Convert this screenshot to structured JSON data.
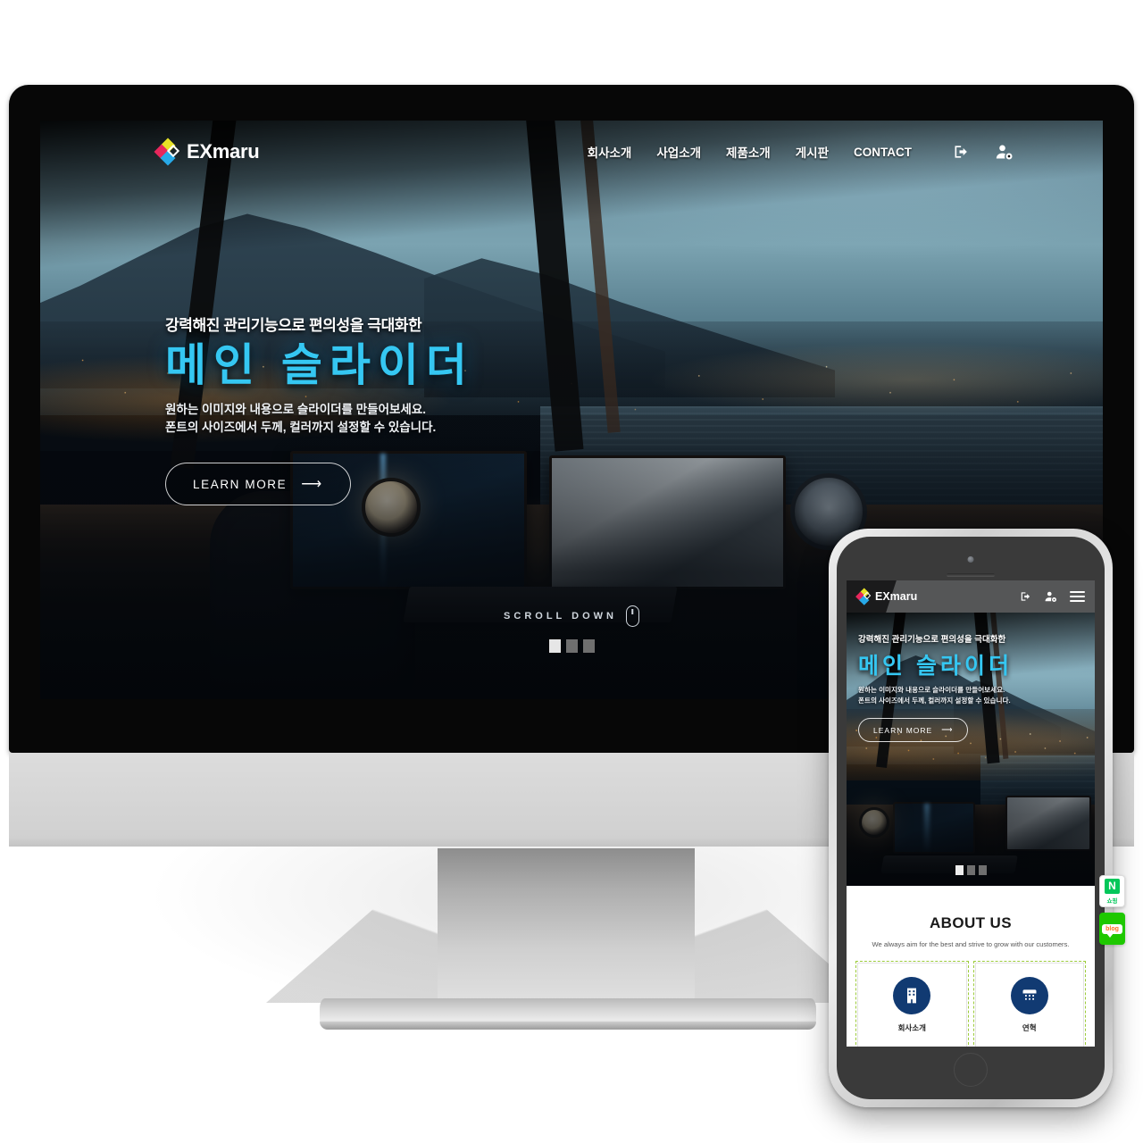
{
  "brand": {
    "name": "EXmaru",
    "logo_colors": [
      "#e8e226",
      "#e8275c",
      "#27a9e8",
      "#ffffff"
    ]
  },
  "desktop": {
    "nav": [
      {
        "label": "회사소개"
      },
      {
        "label": "사업소개"
      },
      {
        "label": "제품소개"
      },
      {
        "label": "게시판"
      },
      {
        "label": "CONTACT"
      }
    ],
    "nav_icons": [
      {
        "name": "logout-icon"
      },
      {
        "name": "user-settings-icon"
      }
    ],
    "hero": {
      "eyebrow": "강력해진 관리기능으로 편의성을 극대화한",
      "title": "메인 슬라이더",
      "desc_line1": "원하는 이미지와 내용으로 슬라이더를 만들어보세요.",
      "desc_line2": "폰트의 사이즈에서 두께, 컬러까지 설정할 수 있습니다.",
      "cta": "LEARN MORE",
      "cta_arrow": "⟶",
      "title_color": "#35c7f2"
    },
    "scroll": {
      "label": "SCROLL DOWN",
      "slides": 3,
      "active_slide": 1
    }
  },
  "mobile": {
    "header_icons": [
      {
        "name": "logout-icon"
      },
      {
        "name": "user-settings-icon"
      },
      {
        "name": "hamburger-menu-icon"
      }
    ],
    "hero": {
      "eyebrow": "강력해진 관리기능으로 편의성을 극대화한",
      "title": "메인 슬라이더",
      "desc_line1": "원하는 이미지와 내용으로 슬라이더를 만들어보세요.",
      "desc_line2": "폰트의 사이즈에서 두께, 컬러까지 설정할 수 있습니다.",
      "cta": "LEARN MORE",
      "cta_arrow": "⟶"
    },
    "slider": {
      "slides": 3,
      "active_slide": 1
    },
    "about": {
      "title": "ABOUT US",
      "subtitle": "We always aim for the best and strive to grow with our customers.",
      "cards": [
        {
          "label": "회사소개",
          "icon": "building-icon"
        },
        {
          "label": "연혁",
          "icon": "calendar-icon"
        }
      ],
      "card_icon_color": "#113a72"
    },
    "float_buttons": [
      {
        "name": "naver-shopping-button",
        "mark": "N",
        "label": "쇼핑",
        "color": "#03c75a"
      },
      {
        "name": "naver-blog-button",
        "label": "blog",
        "color": "#1ec800"
      }
    ]
  }
}
